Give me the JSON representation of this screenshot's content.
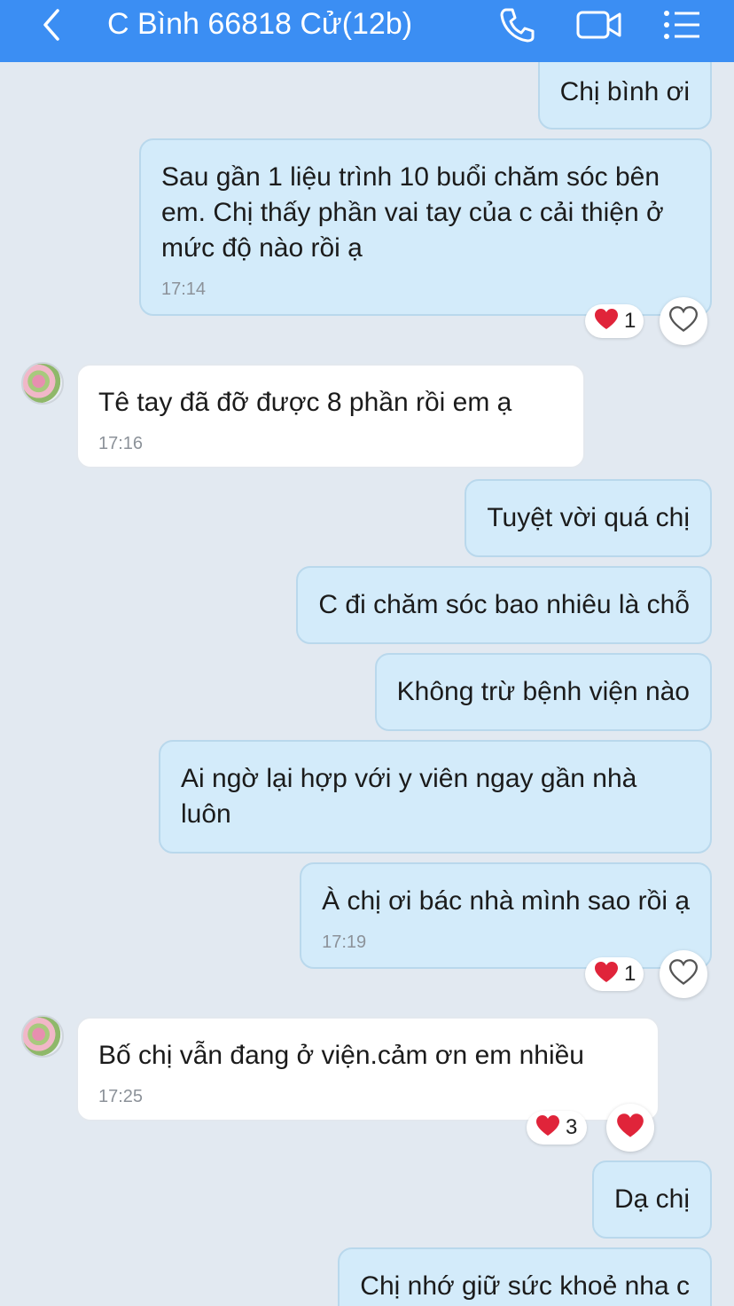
{
  "header": {
    "title": "C Bình 66818 Cử(12b)",
    "background": "#3b8ef3",
    "icons": [
      "back-arrow-icon",
      "phone-icon",
      "video-call-icon",
      "menu-list-icon"
    ]
  },
  "messages": [
    {
      "side": "out",
      "text": "Chị bình ơi"
    },
    {
      "side": "out",
      "text": "Sau gần 1 liệu trình 10 buổi chăm sóc bên em. Chị thấy phần vai tay của c cải thiện ở mức độ nào rồi ạ",
      "time": "17:14",
      "reaction": {
        "icon": "heart-icon",
        "count": "1"
      }
    },
    {
      "side": "in",
      "text": "Tê tay đã đỡ được 8 phần rồi em ạ",
      "time": "17:16"
    },
    {
      "side": "out",
      "text": "Tuyệt vời quá chị"
    },
    {
      "side": "out",
      "text": "C đi chăm sóc bao nhiêu là chỗ"
    },
    {
      "side": "out",
      "text": "Không trừ bệnh viện nào"
    },
    {
      "side": "out",
      "text": "Ai ngờ lại hợp với y viên ngay gần nhà luôn"
    },
    {
      "side": "out",
      "text": "À chị ơi bác nhà mình sao rồi ạ",
      "time": "17:19",
      "reaction": {
        "icon": "heart-icon",
        "count": "1"
      }
    },
    {
      "side": "in",
      "text": "Bố chị vẫn đang ở viện.cảm ơn em nhiều",
      "time": "17:25",
      "reaction": {
        "icon": "heart-icon",
        "count": "3"
      }
    },
    {
      "side": "out",
      "text": "Dạ chị"
    },
    {
      "side": "out",
      "text": "Chị nhớ giữ sức khoẻ nha c"
    }
  ],
  "colors": {
    "chat_background": "#e2e9f1",
    "outgoing_bubble": "#d3ebfa",
    "incoming_bubble": "#ffffff",
    "heart": "#e0243a"
  }
}
